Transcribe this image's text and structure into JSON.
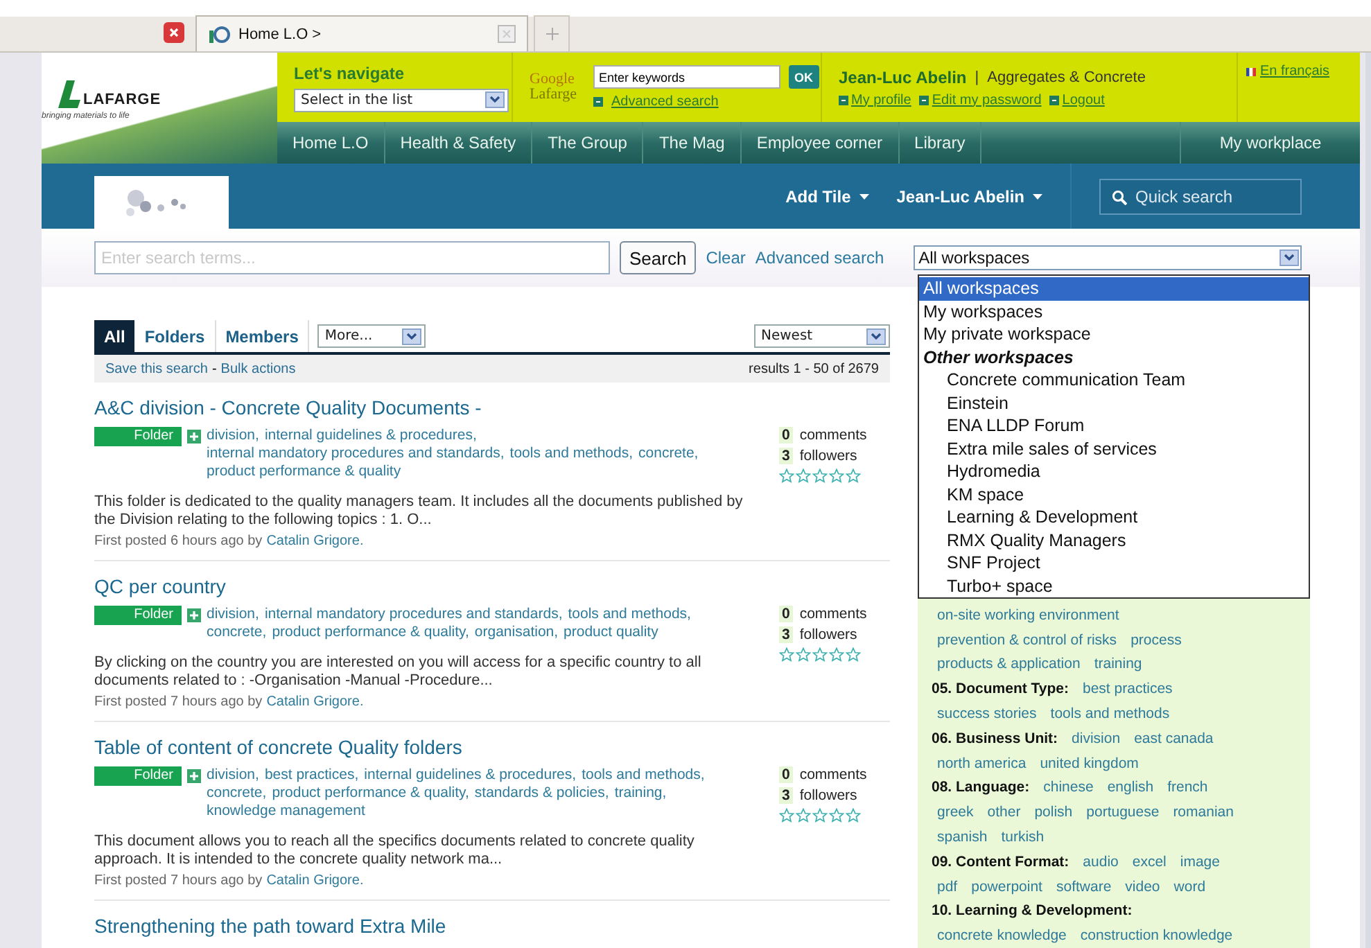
{
  "browser": {
    "tab_title": "Home L.O >"
  },
  "header": {
    "logo_text": "LAFARGE",
    "tagline": "bringing materials to life",
    "navigate_label": "Let's navigate",
    "navigate_select": "Select in the list",
    "google_label": "Google",
    "google_sub": "Lafarge",
    "keywords_value": "Enter keywords",
    "ok_button": "OK",
    "advanced_search": "Advanced search",
    "user_name": "Jean-Luc Abelin",
    "separator": "|",
    "division": "Aggregates & Concrete",
    "user_links": [
      "My profile",
      "Edit my password",
      "Logout"
    ],
    "language_link": "En français"
  },
  "nav": {
    "items": [
      "Home L.O",
      "Health & Safety",
      "The Group",
      "The Mag",
      "Employee corner",
      "Library"
    ],
    "right_item": "My workplace"
  },
  "toolbar": {
    "add_tile": "Add Tile",
    "user_menu": "Jean-Luc Abelin",
    "quick_search_placeholder": "Quick search"
  },
  "search": {
    "placeholder": "Enter search terms...",
    "button": "Search",
    "clear": "Clear",
    "advanced": "Advanced search"
  },
  "workspace_select": {
    "value": "All workspaces",
    "options": [
      {
        "kind": "option",
        "label": "All workspaces",
        "selected": true
      },
      {
        "kind": "option",
        "label": "My workspaces",
        "selected": false
      },
      {
        "kind": "option",
        "label": "My private workspace",
        "selected": false
      },
      {
        "kind": "group",
        "label": "Other workspaces",
        "selected": false,
        "children": [
          {
            "kind": "option",
            "label": "Concrete communication Team",
            "selected": false
          },
          {
            "kind": "option",
            "label": "Einstein",
            "selected": false
          },
          {
            "kind": "option",
            "label": "ENA LLDP Forum",
            "selected": false
          },
          {
            "kind": "option",
            "label": "Extra mile sales of services",
            "selected": false
          },
          {
            "kind": "option",
            "label": "Hydromedia",
            "selected": false
          },
          {
            "kind": "option",
            "label": "KM space",
            "selected": false
          },
          {
            "kind": "option",
            "label": "Learning & Development",
            "selected": false
          },
          {
            "kind": "option",
            "label": "RMX Quality Managers",
            "selected": false
          },
          {
            "kind": "option",
            "label": "SNF Project",
            "selected": false
          },
          {
            "kind": "option",
            "label": "Turbo+ space",
            "selected": false
          }
        ]
      }
    ]
  },
  "result_tabs": [
    {
      "label": "All",
      "selected": true
    },
    {
      "label": "Folders",
      "selected": false
    },
    {
      "label": "Members",
      "selected": false
    }
  ],
  "more_select": "More...",
  "sort_select": "Newest",
  "actions": {
    "save": "Save this search",
    "dash": "-",
    "bulk": "Bulk actions",
    "count": "results 1 - 50 of 2679"
  },
  "results": [
    {
      "title": "A&C division - Concrete Quality Documents -",
      "type": "Folder",
      "tags": [
        "division,",
        "internal guidelines & procedures,",
        "internal mandatory procedures and standards,",
        "tools and methods,",
        "concrete,",
        "product performance & quality"
      ],
      "description": "This folder is dedicated to the quality managers team. It includes all the documents published by the Division relating to the following topics : 1. O...",
      "posted": "First posted 6 hours ago by",
      "author": "Catalin Grigore.",
      "comments": "0",
      "comments_label": "comments",
      "followers": "3",
      "followers_label": "followers",
      "stars": 0
    },
    {
      "title": "QC per country",
      "type": "Folder",
      "tags": [
        "division,",
        "internal mandatory procedures and standards,",
        "tools and methods,",
        "concrete,",
        "product performance & quality,",
        "organisation,",
        "product quality"
      ],
      "description": "By clicking on the country you are interested on you will access for a specific country to all documents related to : -Organisation -Manual -Procedure...",
      "posted": "First posted 7 hours ago by",
      "author": "Catalin Grigore.",
      "comments": "0",
      "comments_label": "comments",
      "followers": "3",
      "followers_label": "followers",
      "stars": 0
    },
    {
      "title": "Table of content of concrete Quality folders",
      "type": "Folder",
      "tags": [
        "division,",
        "best practices,",
        "internal guidelines & procedures,",
        "tools and methods,",
        "concrete,",
        "product performance & quality,",
        "standards & policies,",
        "training,",
        "knowledge management"
      ],
      "description": "This document allows you to reach all the specifics documents related to concrete quality approach. It is intended to the concrete quality network ma...",
      "posted": "First posted 7 hours ago by",
      "author": "Catalin Grigore.",
      "comments": "0",
      "comments_label": "comments",
      "followers": "3",
      "followers_label": "followers",
      "stars": 0
    },
    {
      "title": "Strengthening the path toward Extra Mile"
    }
  ],
  "filters": [
    {
      "tags": [
        "on-site working environment"
      ]
    },
    {
      "tags": [
        "prevention & control of risks",
        "process"
      ]
    },
    {
      "tags": [
        "products & application",
        "training"
      ]
    },
    {
      "heading": "05. Document Type:",
      "tags": [
        "best practices"
      ]
    },
    {
      "tags": [
        "success stories",
        "tools and methods"
      ]
    },
    {
      "heading": "06. Business Unit:",
      "tags": [
        "division",
        "east canada"
      ]
    },
    {
      "tags": [
        "north america",
        "united kingdom"
      ]
    },
    {
      "heading": "08. Language:",
      "tags": [
        "chinese",
        "english",
        "french"
      ]
    },
    {
      "tags": [
        "greek",
        "other",
        "polish",
        "portuguese",
        "romanian"
      ]
    },
    {
      "tags": [
        "spanish",
        "turkish"
      ]
    },
    {
      "heading": "09. Content Format:",
      "tags": [
        "audio",
        "excel",
        "image"
      ]
    },
    {
      "tags": [
        "pdf",
        "powerpoint",
        "software",
        "video",
        "word"
      ]
    },
    {
      "heading": "10. Learning & Development:"
    },
    {
      "tags": [
        "concrete knowledge",
        "construction knowledge"
      ]
    }
  ]
}
